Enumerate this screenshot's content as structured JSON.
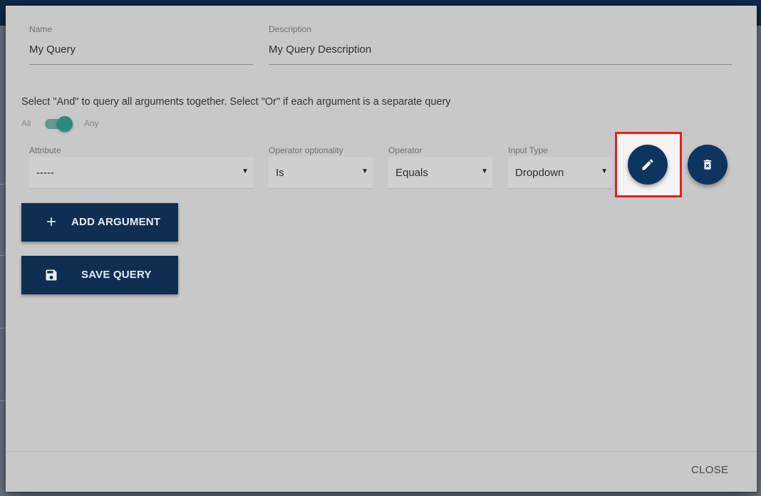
{
  "form": {
    "name": {
      "label": "Name",
      "value": "My Query"
    },
    "description": {
      "label": "Description",
      "value": "My Query Description"
    }
  },
  "hint_text": "Select \"And\" to query all arguments together. Select \"Or\" if each argument is a separate query",
  "toggle": {
    "left_label": "All",
    "right_label": "Any",
    "state": "Any"
  },
  "argument_row": {
    "attribute": {
      "label": "Attribute",
      "value": "-----"
    },
    "operator_optionality": {
      "label": "Operator optionality",
      "value": "Is"
    },
    "operator": {
      "label": "Operator",
      "value": "Equals"
    },
    "input_type": {
      "label": "Input Type",
      "value": "Dropdown"
    },
    "edit_icon": "pencil-icon",
    "delete_icon": "trash-icon"
  },
  "buttons": {
    "add_argument": {
      "label": "ADD ARGUMENT",
      "icon": "plus-icon"
    },
    "save_query": {
      "label": "SAVE QUERY",
      "icon": "floppy-disk-icon"
    }
  },
  "footer": {
    "close_label": "CLOSE"
  },
  "colors": {
    "primary": "#0f2e52",
    "toggle": "#2c8a7c",
    "highlight": "#ee1c1c",
    "dialog_bg": "#c8c8c8"
  }
}
